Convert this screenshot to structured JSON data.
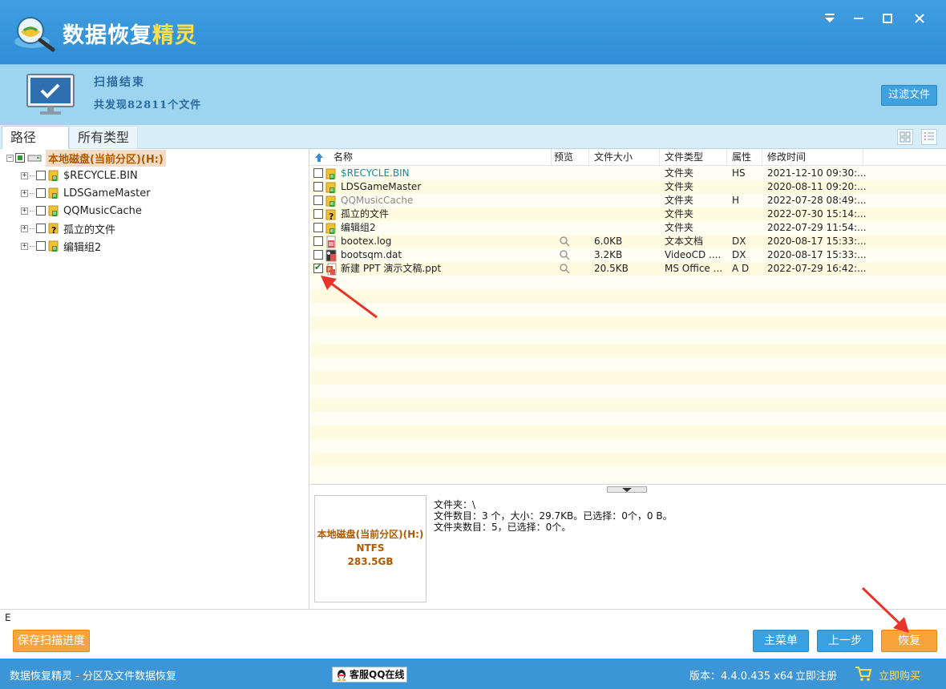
{
  "app": {
    "title_main": "数据恢复",
    "title_accent": "精灵"
  },
  "window_controls": [
    "menu-icon",
    "minimize-icon",
    "maximize-icon",
    "close-icon"
  ],
  "scan": {
    "status": "扫描结束",
    "summary": "共发现82811个文件"
  },
  "filter_button": "过滤文件",
  "tabs": [
    {
      "label": "路径",
      "active": true
    },
    {
      "label": "所有类型",
      "active": false
    }
  ],
  "tree": {
    "root": "本地磁盘(当前分区)(H:)",
    "children": [
      {
        "label": "$RECYCLE.BIN",
        "icon": "recycle-folder-icon"
      },
      {
        "label": "LDSGameMaster",
        "icon": "recycle-folder-icon"
      },
      {
        "label": "QQMusicCache",
        "icon": "recycle-folder-icon"
      },
      {
        "label": "孤立的文件",
        "icon": "unknown-folder-icon"
      },
      {
        "label": "编辑组2",
        "icon": "recycle-folder-icon"
      }
    ]
  },
  "list": {
    "columns": [
      "名称",
      "预览",
      "文件大小",
      "文件类型",
      "属性",
      "修改时间"
    ],
    "rows": [
      {
        "name": "$RECYCLE.BIN",
        "size": "",
        "type": "文件夹",
        "attr": "HS",
        "modified": "2021-12-10 09:30:...",
        "name_color": "#1a8a9a",
        "icon": "recycle-folder-icon",
        "checked": false,
        "preview": false
      },
      {
        "name": "LDSGameMaster",
        "size": "",
        "type": "文件夹",
        "attr": "",
        "modified": "2020-08-11 09:20:...",
        "name_color": "#222222",
        "icon": "recycle-folder-icon",
        "checked": false,
        "preview": false
      },
      {
        "name": "QQMusicCache",
        "size": "",
        "type": "文件夹",
        "attr": "H",
        "modified": "2022-07-28 08:49:...",
        "name_color": "#8a8a8a",
        "icon": "recycle-folder-icon",
        "checked": false,
        "preview": false
      },
      {
        "name": "孤立的文件",
        "size": "",
        "type": "文件夹",
        "attr": "",
        "modified": "2022-07-30 15:14:...",
        "name_color": "#222222",
        "icon": "unknown-folder-icon",
        "checked": false,
        "preview": false
      },
      {
        "name": "编辑组2",
        "size": "",
        "type": "文件夹",
        "attr": "",
        "modified": "2022-07-29 11:54:...",
        "name_color": "#222222",
        "icon": "recycle-folder-icon",
        "checked": false,
        "preview": false
      },
      {
        "name": "bootex.log",
        "size": "6.0KB",
        "type": "文本文档",
        "attr": "DX",
        "modified": "2020-08-17 15:33:...",
        "name_color": "#222222",
        "icon": "deleted-file-icon",
        "checked": false,
        "preview": true
      },
      {
        "name": "bootsqm.dat",
        "size": "3.2KB",
        "type": "VideoCD ....",
        "attr": "DX",
        "modified": "2020-08-17 15:33:...",
        "name_color": "#222222",
        "icon": "video-file-icon",
        "checked": false,
        "preview": true
      },
      {
        "name": "新建 PPT 演示文稿.ppt",
        "size": "20.5KB",
        "type": "MS Office ...",
        "attr": "A D",
        "modified": "2022-07-29 16:42:...",
        "name_color": "#222222",
        "icon": "ppt-file-icon",
        "checked": true,
        "preview": true
      }
    ]
  },
  "disk_card": {
    "name": "本地磁盘(当前分区)(H:)",
    "fs": "NTFS",
    "size": "283.5GB"
  },
  "info_text": {
    "line1": "文件夹：\\",
    "line2": "文件数目：3 个，大小：29.7KB。已选择：0个，0 B。",
    "line3": "文件夹数目：5，已选择：0个。"
  },
  "status_line": "E",
  "buttons": {
    "save_progress": "保存扫描进度",
    "main_menu": "主菜单",
    "prev_step": "上一步",
    "recover": "恢复"
  },
  "footer": {
    "left": "数据恢复精灵 - 分区及文件数据恢复",
    "qq": "客服QQ在线",
    "version": "版本：4.4.0.435 x64",
    "register": "立即注册",
    "buy": "立即购买"
  },
  "colors": {
    "titlebar": "#3f9fe0",
    "band": "#9dd4f0",
    "accent_orange": "#f6a43b",
    "button_blue": "#3ba0e0",
    "footer": "#3b95d6",
    "root_label_text": "#b05a00",
    "annotation_arrow": "#e8342a"
  }
}
